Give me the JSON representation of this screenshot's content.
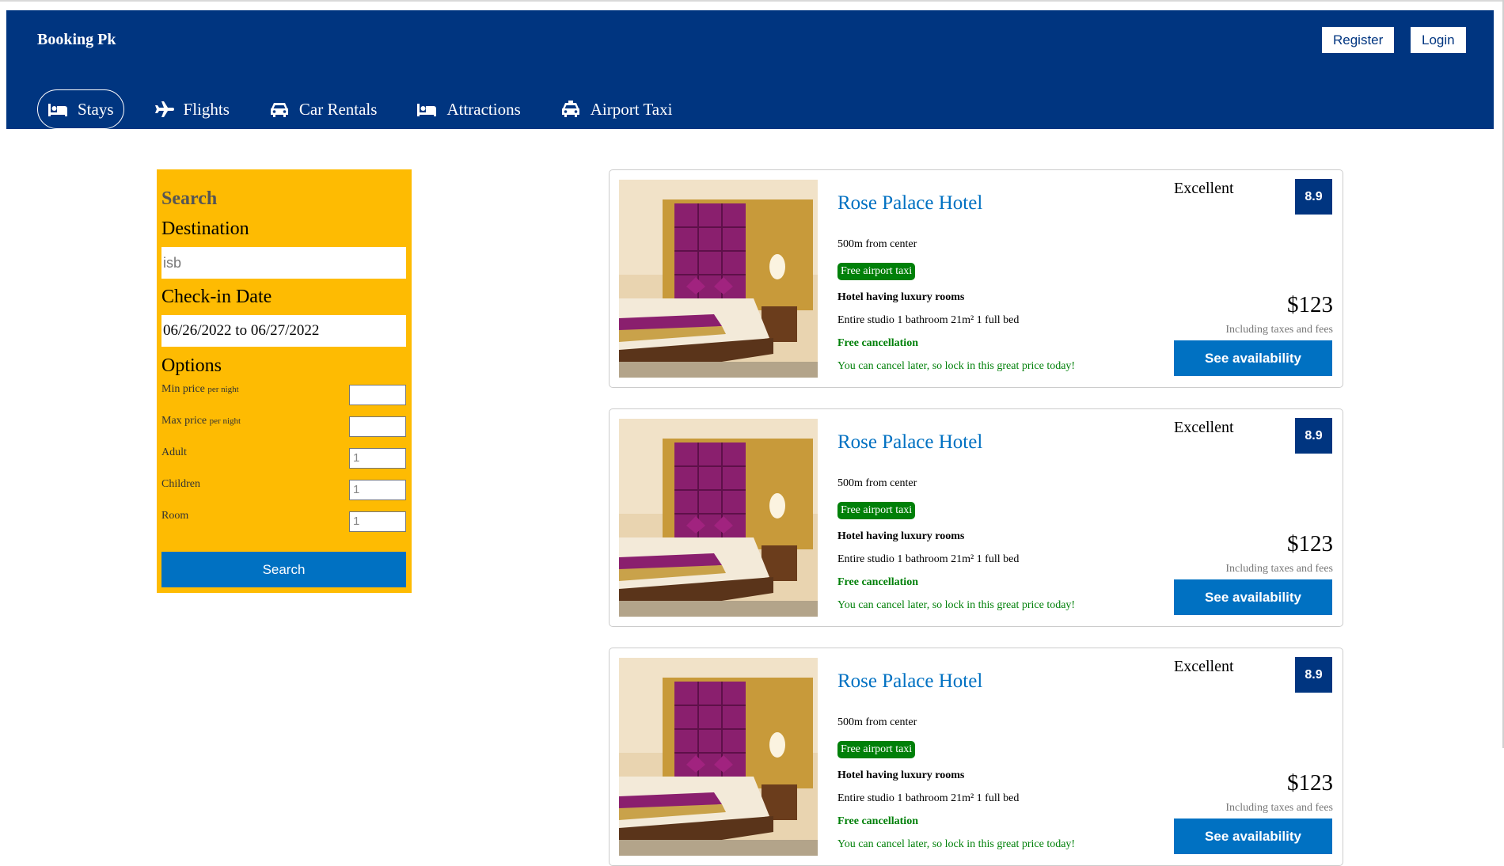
{
  "header": {
    "brand": "Booking Pk",
    "register_label": "Register",
    "login_label": "Login",
    "nav": [
      {
        "label": "Stays",
        "icon": "bed-icon",
        "active": true
      },
      {
        "label": "Flights",
        "icon": "plane-icon"
      },
      {
        "label": "Car Rentals",
        "icon": "car-icon"
      },
      {
        "label": "Attractions",
        "icon": "bed-icon"
      },
      {
        "label": "Airport Taxi",
        "icon": "taxi-icon"
      }
    ]
  },
  "search": {
    "title": "Search",
    "destination_label": "Destination",
    "destination_value": "isb",
    "checkin_label": "Check-in Date",
    "checkin_value": "06/26/2022 to 06/27/2022",
    "options_label": "Options",
    "options": [
      {
        "label": "Min price",
        "suffix": "per night",
        "value": ""
      },
      {
        "label": "Max price",
        "suffix": "per night",
        "value": ""
      },
      {
        "label": "Adult",
        "suffix": "",
        "value": "1"
      },
      {
        "label": "Children",
        "suffix": "",
        "value": "1"
      },
      {
        "label": "Room",
        "suffix": "",
        "value": "1"
      }
    ],
    "button_label": "Search"
  },
  "results": [
    {
      "name": "Rose Palace Hotel",
      "distance": "500m from center",
      "taxi": "Free airport taxi",
      "subtitle": "Hotel having luxury rooms",
      "features": "Entire studio 1 bathroom 21m² 1 full bed",
      "cancel": "Free cancellation",
      "cancel_sub": "You can cancel later, so lock in this great price today!",
      "rating_text": "Excellent",
      "rating": "8.9",
      "price": "$123",
      "tax": "Including taxes and fees",
      "button": "See availability"
    },
    {
      "name": "Rose Palace Hotel",
      "distance": "500m from center",
      "taxi": "Free airport taxi",
      "subtitle": "Hotel having luxury rooms",
      "features": "Entire studio 1 bathroom 21m² 1 full bed",
      "cancel": "Free cancellation",
      "cancel_sub": "You can cancel later, so lock in this great price today!",
      "rating_text": "Excellent",
      "rating": "8.9",
      "price": "$123",
      "tax": "Including taxes and fees",
      "button": "See availability"
    },
    {
      "name": "Rose Palace Hotel",
      "distance": "500m from center",
      "taxi": "Free airport taxi",
      "subtitle": "Hotel having luxury rooms",
      "features": "Entire studio 1 bathroom 21m² 1 full bed",
      "cancel": "Free cancellation",
      "cancel_sub": "You can cancel later, so lock in this great price today!",
      "rating_text": "Excellent",
      "rating": "8.9",
      "price": "$123",
      "tax": "Including taxes and fees",
      "button": "See availability"
    }
  ],
  "colors": {
    "header_bg": "#003580",
    "sidebar_bg": "#febb02",
    "primary_button": "#0071c2",
    "success_green": "#008009",
    "hotel_link": "#0071c2"
  }
}
